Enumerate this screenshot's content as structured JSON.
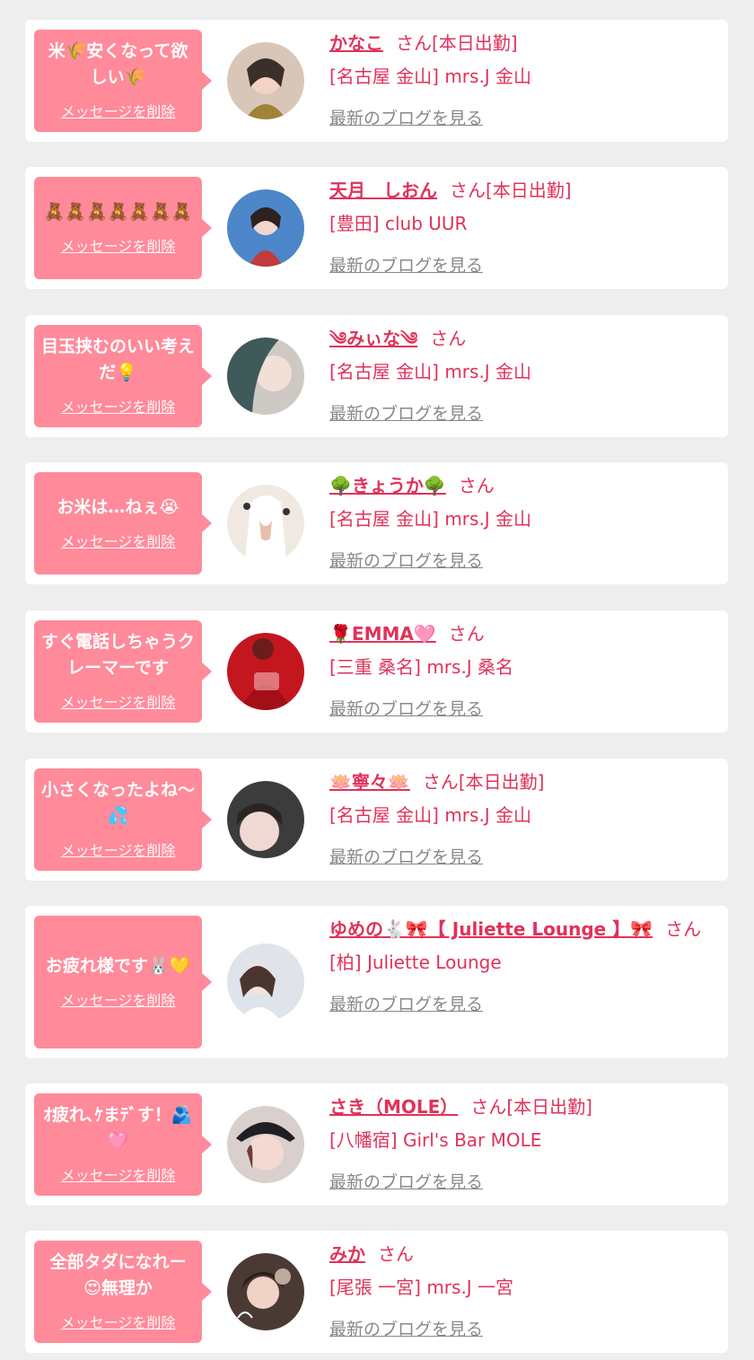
{
  "messages": [
    {
      "bubble_text": "米🌾安くなって欲しい🌾",
      "delete_label": "メッセージを削除",
      "name": "かなこ",
      "honorific": "さん",
      "status": "[本日出勤]",
      "shop": "[名古屋 金山] mrs.J 金山",
      "blog_label": "最新のブログを見る"
    },
    {
      "bubble_text": "🧸🧸🧸🧸🧸🧸🧸",
      "delete_label": "メッセージを削除",
      "name": "天月　しおん",
      "honorific": "さん",
      "status": "[本日出勤]",
      "shop": "[豊田] club UUR",
      "blog_label": "最新のブログを見る"
    },
    {
      "bubble_text": "目玉挟むのいい考えだ💡",
      "delete_label": "メッセージを削除",
      "name": "༄みぃな༄",
      "honorific": "さん",
      "status": "",
      "shop": "[名古屋 金山] mrs.J 金山",
      "blog_label": "最新のブログを見る"
    },
    {
      "bubble_text": "お米は…ねぇ😭",
      "delete_label": "メッセージを削除",
      "name": "🌳きょうか🌳",
      "honorific": "さん",
      "status": "",
      "shop": "[名古屋 金山] mrs.J 金山",
      "blog_label": "最新のブログを見る"
    },
    {
      "bubble_text": "すぐ電話しちゃうクレーマーです",
      "delete_label": "メッセージを削除",
      "name": "🌹EMMA🩷",
      "honorific": "さん",
      "status": "",
      "shop": "[三重 桑名] mrs.J 桑名",
      "blog_label": "最新のブログを見る"
    },
    {
      "bubble_text": "小さくなったよね〜💦",
      "delete_label": "メッセージを削除",
      "name": "🪷寧々🪷",
      "honorific": "さん",
      "status": "[本日出勤]",
      "shop": "[名古屋 金山] mrs.J 金山",
      "blog_label": "最新のブログを見る"
    },
    {
      "bubble_text": "お疲れ様です🐰💛",
      "delete_label": "メッセージを削除",
      "name": "ゆめの🐇🎀【 Juliette Lounge 】🎀",
      "honorific": "さん",
      "status": "",
      "shop": "[柏] Juliette Lounge",
      "blog_label": "最新のブログを見る"
    },
    {
      "bubble_text": "ｵ疲れ､ｹまﾃﾞす！🫂🩷",
      "delete_label": "メッセージを削除",
      "name": "さき（MOLE）",
      "honorific": "さん",
      "status": "[本日出勤]",
      "shop": "[八幡宿] Girl's Bar MOLE",
      "blog_label": "最新のブログを見る"
    },
    {
      "bubble_text": "全部タダになれー😍無理か",
      "delete_label": "メッセージを削除",
      "name": "みか",
      "honorific": "さん",
      "status": "",
      "shop": "[尾張 一宮] mrs.J 一宮",
      "blog_label": "最新のブログを見る"
    }
  ],
  "colors": {
    "page_background": "#eeeeee",
    "card_background": "#ffffff",
    "bubble_background": "#ff8a9a",
    "accent_text": "#e0325a",
    "link_gray": "#888888"
  },
  "avatar_tints": [
    "#3b2f2a",
    "#c33a3a",
    "#3f5a58",
    "#e8e2da",
    "#c4161f",
    "#3c3c3c",
    "#dfe3ea",
    "#6e3c3a",
    "#4a3a33"
  ]
}
